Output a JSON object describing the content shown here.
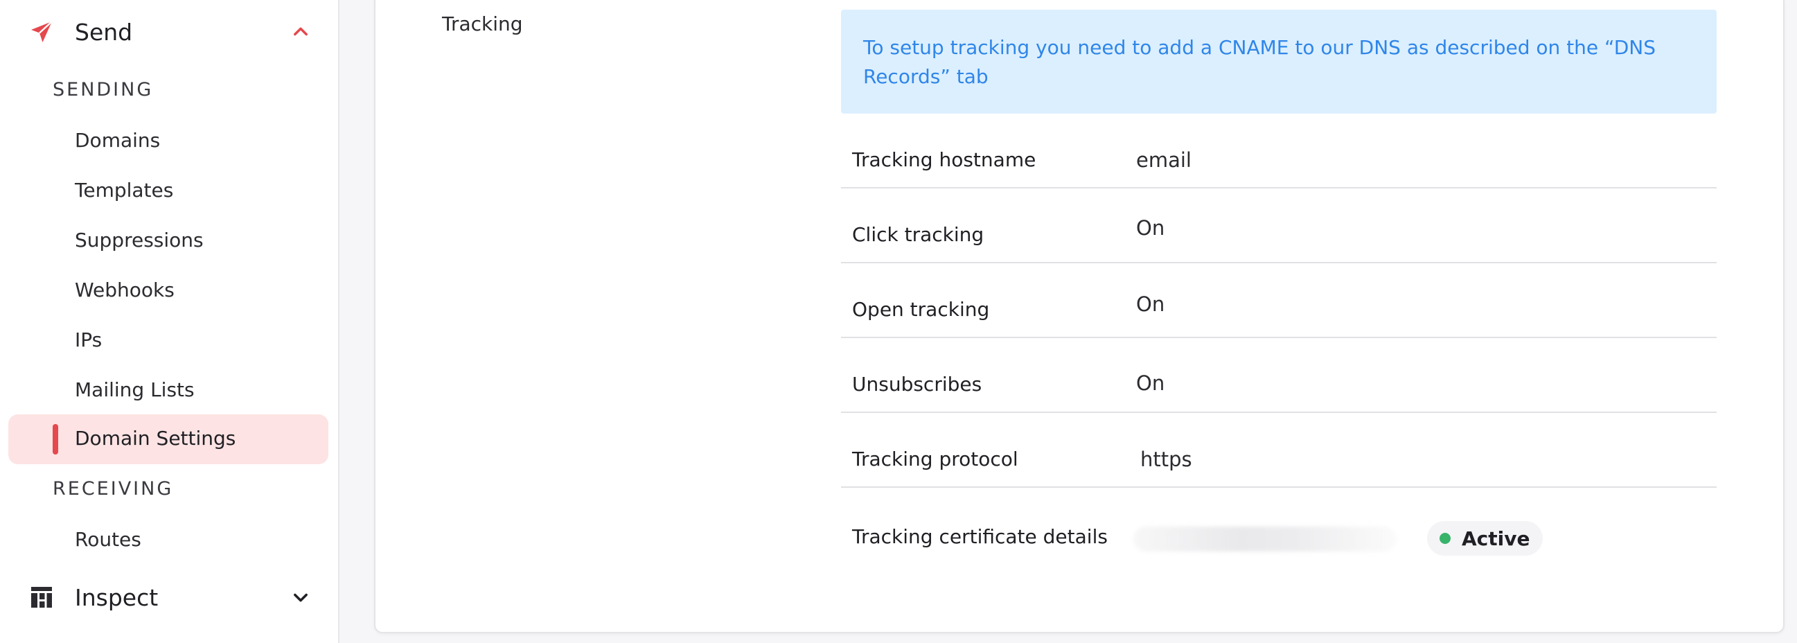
{
  "sidebar": {
    "send": {
      "label": "Send",
      "icon": "paper-plane-icon",
      "expanded": true
    },
    "sending_section": "SENDING",
    "sending_items": [
      {
        "label": "Domains"
      },
      {
        "label": "Templates"
      },
      {
        "label": "Suppressions"
      },
      {
        "label": "Webhooks"
      },
      {
        "label": "IPs"
      },
      {
        "label": "Mailing Lists"
      }
    ],
    "active_item": {
      "label": "Domain Settings"
    },
    "receiving_section": "RECEIVING",
    "receiving_items": [
      {
        "label": "Routes"
      }
    ],
    "inspect": {
      "label": "Inspect",
      "icon": "dashboard-icon",
      "expanded": false
    }
  },
  "main": {
    "section_title": "Tracking",
    "info_message": "To setup tracking you need to add a CNAME to our DNS as described on the “DNS Records” tab",
    "rows": [
      {
        "key": "Tracking hostname",
        "value": "email"
      },
      {
        "key": "Click tracking",
        "value": "On"
      },
      {
        "key": "Open tracking",
        "value": "On"
      },
      {
        "key": "Unsubscribes",
        "value": "On"
      },
      {
        "key": "Tracking protocol",
        "value": "https"
      },
      {
        "key": "Tracking certificate details",
        "value": ""
      }
    ],
    "certificate_status": {
      "label": "Active",
      "color": "#38b36a"
    }
  },
  "colors": {
    "accent": "#e5484d",
    "active_bg": "#fde3e3",
    "info_bg": "#dcefff",
    "info_text": "#2f86e8"
  }
}
